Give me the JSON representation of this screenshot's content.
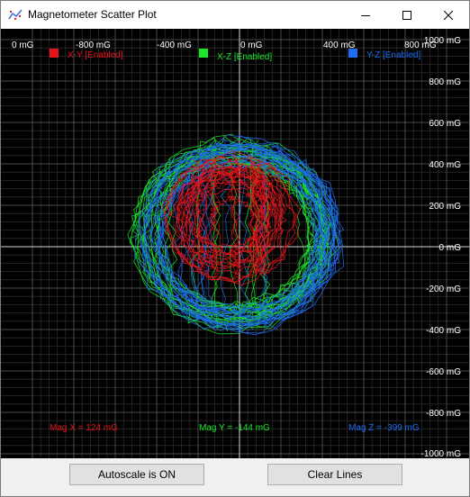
{
  "window": {
    "title": "Magnetometer Scatter Plot",
    "icons": {
      "app": "scatter-plot-app-icon",
      "minimize": "minimize-icon",
      "maximize": "maximize-icon",
      "close": "close-icon"
    }
  },
  "chart_data": {
    "type": "scatter",
    "title": "",
    "xlabel": "",
    "ylabel": "",
    "units": "mG",
    "x_ticks": [
      "0 mG",
      "-800 mG",
      "-400 mG",
      "0 mG",
      "400 mG",
      "800 mG"
    ],
    "y_ticks": [
      "1000 mG",
      "800 mG",
      "600 mG",
      "400 mG",
      "200 mG",
      "0 mG",
      "-200 mG",
      "-400 mG",
      "-600 mG",
      "-800 mG",
      "-1000 mG"
    ],
    "xlim": [
      -1000,
      1000
    ],
    "ylim": [
      -1000,
      1000
    ],
    "grid": true,
    "legend_position": "top",
    "series": [
      {
        "name": "X-Y [Enabled]",
        "color": "#e8141c",
        "center": [
          -40,
          140
        ],
        "radius": [
          330,
          320
        ]
      },
      {
        "name": "X-Z [Enabled]",
        "color": "#18e82a",
        "center": [
          -30,
          60
        ],
        "radius": [
          500,
          470
        ]
      },
      {
        "name": "Y-Z [Enabled]",
        "color": "#1e6cf0",
        "center": [
          0,
          50
        ],
        "radius": [
          510,
          480
        ]
      }
    ],
    "readouts": [
      {
        "label": "Mag X = 124 mG",
        "color": "#e8141c"
      },
      {
        "label": "Mag Y = -144 mG",
        "color": "#18e82a"
      },
      {
        "label": "Mag Z = -399 mG",
        "color": "#1e6cf0"
      }
    ]
  },
  "buttons": {
    "autoscale": "Autoscale is ON",
    "clear": "Clear Lines"
  }
}
